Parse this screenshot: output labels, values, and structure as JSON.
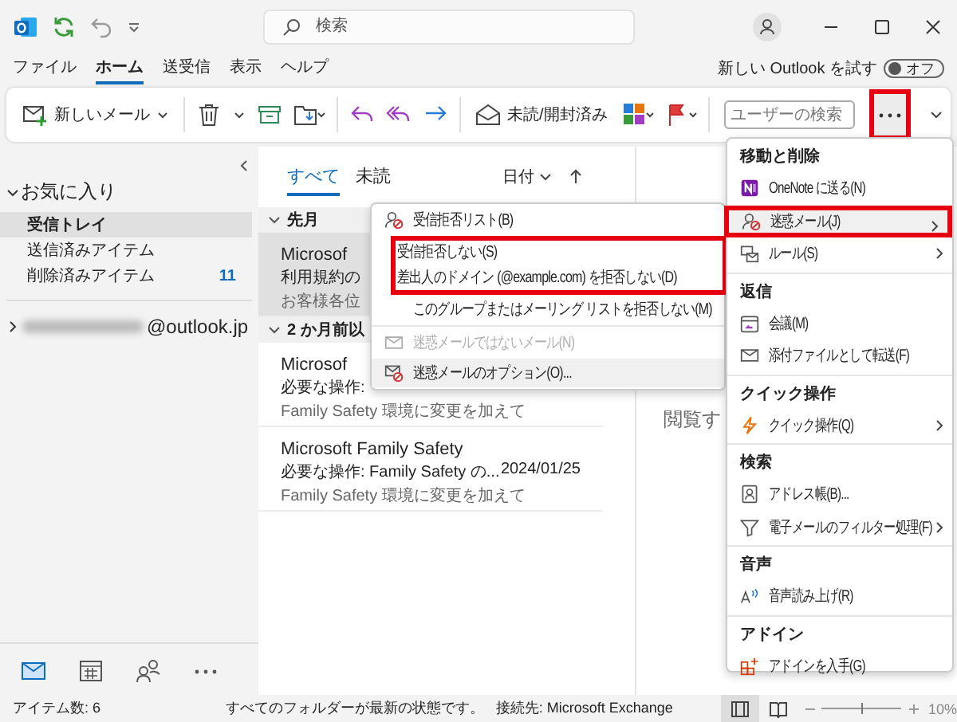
{
  "title_bar": {
    "search": {
      "placeholder": "検索"
    }
  },
  "menu_tabs": [
    {
      "label": "ファイル",
      "selected": false
    },
    {
      "label": "ホーム",
      "selected": true
    },
    {
      "label": "送受信",
      "selected": false
    },
    {
      "label": "表示",
      "selected": false
    },
    {
      "label": "ヘルプ",
      "selected": false
    }
  ],
  "new_outlook": {
    "label": "新しい Outlook を試す",
    "toggle": {
      "on": false,
      "label": "オフ"
    }
  },
  "ribbon": {
    "new_mail": "新しいメール",
    "read_unread": "未読/開封済み",
    "people_search": {
      "placeholder": "ユーザーの検索"
    },
    "more_button": {
      "highlighted": true
    }
  },
  "folder_pane": {
    "favorites": {
      "label": "お気に入り",
      "expanded": true,
      "folders": [
        {
          "name": "受信トレイ",
          "selected": true
        },
        {
          "name": "送信済みアイテム",
          "selected": false
        },
        {
          "name": "削除済みアイテム",
          "count": "11",
          "selected": false
        }
      ]
    },
    "account": {
      "address": "@outlook.jp",
      "expanded": false
    },
    "nav": [
      {
        "kind": "mail",
        "selected": true
      },
      {
        "kind": "calendar",
        "selected": false
      },
      {
        "kind": "people",
        "selected": false
      },
      {
        "kind": "more",
        "selected": false
      }
    ]
  },
  "message_list": {
    "filters": [
      {
        "label": "すべて",
        "selected": true
      },
      {
        "label": "未読",
        "selected": false
      }
    ],
    "sort": {
      "label": "日付"
    },
    "groups": [
      {
        "label": "先月",
        "expanded": true,
        "messages": [
          {
            "sender": "Microsof",
            "subject": "利用規約の",
            "preview": "お客様各位",
            "selected": true
          }
        ]
      },
      {
        "label": "2 か月前以",
        "expanded": true,
        "messages": [
          {
            "sender": "Microsof",
            "subject": "必要な操作:",
            "preview": "Family Safety 環境に変更を加えて",
            "selected": false
          },
          {
            "sender": "Microsoft Family Safety",
            "subject": "必要な操作: Family Safety の...",
            "date": "2024/01/25",
            "preview": "Family Safety 環境に変更を加えて",
            "selected": false
          }
        ]
      }
    ]
  },
  "reading_pane": {
    "hint": "閲覧す"
  },
  "junk_submenu": {
    "items": [
      {
        "kind": "blocked-senders",
        "label": "受信拒否リスト(B)",
        "disabled": false,
        "hovered": false,
        "highlighted": false
      },
      {
        "kind": "none",
        "label": "受信拒否しない(S)",
        "disabled": false,
        "hovered": false,
        "highlighted": true
      },
      {
        "kind": "none",
        "label": "差出人のドメイン (@example.com) を拒否しない(D)",
        "disabled": false,
        "hovered": false,
        "highlighted": true
      },
      {
        "kind": "none",
        "label": "このグループまたはメーリング リストを拒否しない(M)",
        "disabled": false,
        "hovered": false,
        "highlighted": false
      },
      {
        "kind": "mail",
        "label": "迷惑メールではないメール(N)",
        "disabled": true,
        "hovered": false,
        "highlighted": false
      },
      {
        "kind": "junk-options",
        "label": "迷惑メールのオプション(O)...",
        "disabled": false,
        "hovered": true,
        "highlighted": false
      }
    ]
  },
  "more_menu": {
    "sections": [
      {
        "title": "移動と削除",
        "items": [
          {
            "kind": "onenote",
            "label": "OneNote に送る(N)",
            "submenu": false,
            "selected": false,
            "highlighted": false
          },
          {
            "kind": "junk",
            "label": "迷惑メール(J)",
            "submenu": true,
            "selected": true,
            "highlighted": true
          },
          {
            "kind": "rules",
            "label": "ルール(S)",
            "submenu": true,
            "selected": false,
            "highlighted": false
          }
        ]
      },
      {
        "title": "返信",
        "items": [
          {
            "kind": "meeting",
            "label": "会議(M)",
            "submenu": false,
            "selected": false,
            "highlighted": false
          },
          {
            "kind": "forward-attachment",
            "label": "添付ファイルとして転送(F)",
            "submenu": false,
            "selected": false,
            "highlighted": false
          }
        ]
      },
      {
        "title": "クイック操作",
        "items": [
          {
            "kind": "quick-steps",
            "label": "クイック操作(Q)",
            "submenu": true,
            "selected": false,
            "highlighted": false
          }
        ]
      },
      {
        "title": "検索",
        "items": [
          {
            "kind": "address-book",
            "label": "アドレス帳(B)...",
            "submenu": false,
            "selected": false,
            "highlighted": false
          },
          {
            "kind": "filter",
            "label": "電子メールのフィルター処理(F)",
            "submenu": true,
            "selected": false,
            "highlighted": false
          }
        ]
      },
      {
        "title": "音声",
        "items": [
          {
            "kind": "read-aloud",
            "label": "音声読み上げ(R)",
            "submenu": false,
            "selected": false,
            "highlighted": false
          }
        ]
      },
      {
        "title": "アドイン",
        "items": [
          {
            "kind": "addins",
            "label": "アドインを入手(G)",
            "submenu": false,
            "selected": false,
            "highlighted": false
          }
        ]
      }
    ]
  },
  "status_bar": {
    "item_count": "アイテム数: 6",
    "sync_status": "すべてのフォルダーが最新の状態です。",
    "connection": "接続先: Microsoft Exchange",
    "views": [
      {
        "kind": "normal",
        "selected": true
      },
      {
        "kind": "reading",
        "selected": false
      }
    ],
    "zoom": {
      "level": 0.5,
      "label": "10%"
    }
  }
}
